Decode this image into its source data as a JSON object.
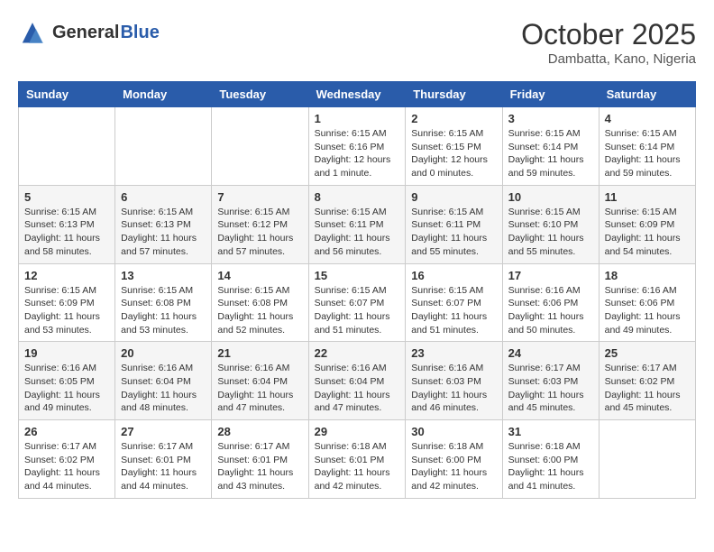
{
  "header": {
    "logo_general": "General",
    "logo_blue": "Blue",
    "month": "October 2025",
    "location": "Dambatta, Kano, Nigeria"
  },
  "calendar": {
    "days_of_week": [
      "Sunday",
      "Monday",
      "Tuesday",
      "Wednesday",
      "Thursday",
      "Friday",
      "Saturday"
    ],
    "weeks": [
      [
        {
          "day": "",
          "info": ""
        },
        {
          "day": "",
          "info": ""
        },
        {
          "day": "",
          "info": ""
        },
        {
          "day": "1",
          "info": "Sunrise: 6:15 AM\nSunset: 6:16 PM\nDaylight: 12 hours\nand 1 minute."
        },
        {
          "day": "2",
          "info": "Sunrise: 6:15 AM\nSunset: 6:15 PM\nDaylight: 12 hours\nand 0 minutes."
        },
        {
          "day": "3",
          "info": "Sunrise: 6:15 AM\nSunset: 6:14 PM\nDaylight: 11 hours\nand 59 minutes."
        },
        {
          "day": "4",
          "info": "Sunrise: 6:15 AM\nSunset: 6:14 PM\nDaylight: 11 hours\nand 59 minutes."
        }
      ],
      [
        {
          "day": "5",
          "info": "Sunrise: 6:15 AM\nSunset: 6:13 PM\nDaylight: 11 hours\nand 58 minutes."
        },
        {
          "day": "6",
          "info": "Sunrise: 6:15 AM\nSunset: 6:13 PM\nDaylight: 11 hours\nand 57 minutes."
        },
        {
          "day": "7",
          "info": "Sunrise: 6:15 AM\nSunset: 6:12 PM\nDaylight: 11 hours\nand 57 minutes."
        },
        {
          "day": "8",
          "info": "Sunrise: 6:15 AM\nSunset: 6:11 PM\nDaylight: 11 hours\nand 56 minutes."
        },
        {
          "day": "9",
          "info": "Sunrise: 6:15 AM\nSunset: 6:11 PM\nDaylight: 11 hours\nand 55 minutes."
        },
        {
          "day": "10",
          "info": "Sunrise: 6:15 AM\nSunset: 6:10 PM\nDaylight: 11 hours\nand 55 minutes."
        },
        {
          "day": "11",
          "info": "Sunrise: 6:15 AM\nSunset: 6:09 PM\nDaylight: 11 hours\nand 54 minutes."
        }
      ],
      [
        {
          "day": "12",
          "info": "Sunrise: 6:15 AM\nSunset: 6:09 PM\nDaylight: 11 hours\nand 53 minutes."
        },
        {
          "day": "13",
          "info": "Sunrise: 6:15 AM\nSunset: 6:08 PM\nDaylight: 11 hours\nand 53 minutes."
        },
        {
          "day": "14",
          "info": "Sunrise: 6:15 AM\nSunset: 6:08 PM\nDaylight: 11 hours\nand 52 minutes."
        },
        {
          "day": "15",
          "info": "Sunrise: 6:15 AM\nSunset: 6:07 PM\nDaylight: 11 hours\nand 51 minutes."
        },
        {
          "day": "16",
          "info": "Sunrise: 6:15 AM\nSunset: 6:07 PM\nDaylight: 11 hours\nand 51 minutes."
        },
        {
          "day": "17",
          "info": "Sunrise: 6:16 AM\nSunset: 6:06 PM\nDaylight: 11 hours\nand 50 minutes."
        },
        {
          "day": "18",
          "info": "Sunrise: 6:16 AM\nSunset: 6:06 PM\nDaylight: 11 hours\nand 49 minutes."
        }
      ],
      [
        {
          "day": "19",
          "info": "Sunrise: 6:16 AM\nSunset: 6:05 PM\nDaylight: 11 hours\nand 49 minutes."
        },
        {
          "day": "20",
          "info": "Sunrise: 6:16 AM\nSunset: 6:04 PM\nDaylight: 11 hours\nand 48 minutes."
        },
        {
          "day": "21",
          "info": "Sunrise: 6:16 AM\nSunset: 6:04 PM\nDaylight: 11 hours\nand 47 minutes."
        },
        {
          "day": "22",
          "info": "Sunrise: 6:16 AM\nSunset: 6:04 PM\nDaylight: 11 hours\nand 47 minutes."
        },
        {
          "day": "23",
          "info": "Sunrise: 6:16 AM\nSunset: 6:03 PM\nDaylight: 11 hours\nand 46 minutes."
        },
        {
          "day": "24",
          "info": "Sunrise: 6:17 AM\nSunset: 6:03 PM\nDaylight: 11 hours\nand 45 minutes."
        },
        {
          "day": "25",
          "info": "Sunrise: 6:17 AM\nSunset: 6:02 PM\nDaylight: 11 hours\nand 45 minutes."
        }
      ],
      [
        {
          "day": "26",
          "info": "Sunrise: 6:17 AM\nSunset: 6:02 PM\nDaylight: 11 hours\nand 44 minutes."
        },
        {
          "day": "27",
          "info": "Sunrise: 6:17 AM\nSunset: 6:01 PM\nDaylight: 11 hours\nand 44 minutes."
        },
        {
          "day": "28",
          "info": "Sunrise: 6:17 AM\nSunset: 6:01 PM\nDaylight: 11 hours\nand 43 minutes."
        },
        {
          "day": "29",
          "info": "Sunrise: 6:18 AM\nSunset: 6:01 PM\nDaylight: 11 hours\nand 42 minutes."
        },
        {
          "day": "30",
          "info": "Sunrise: 6:18 AM\nSunset: 6:00 PM\nDaylight: 11 hours\nand 42 minutes."
        },
        {
          "day": "31",
          "info": "Sunrise: 6:18 AM\nSunset: 6:00 PM\nDaylight: 11 hours\nand 41 minutes."
        },
        {
          "day": "",
          "info": ""
        }
      ]
    ]
  }
}
